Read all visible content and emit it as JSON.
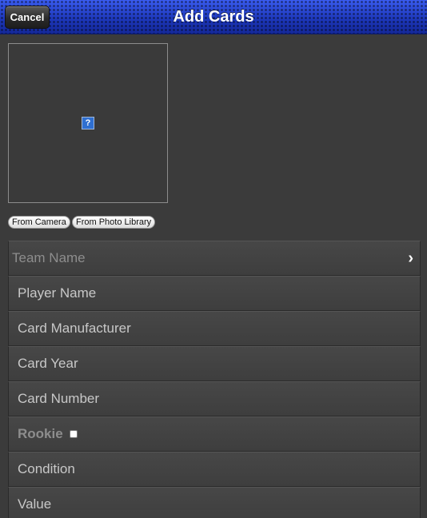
{
  "header": {
    "title": "Add Cards",
    "cancel_label": "Cancel"
  },
  "photo": {
    "placeholder_icon": "broken-image-icon",
    "placeholder_glyph": "?",
    "from_camera_label": "From Camera",
    "from_library_label": "From Photo Library"
  },
  "form": {
    "team_placeholder": "Team Name",
    "player_name_placeholder": "Player Name",
    "card_manufacturer_placeholder": "Card Manufacturer",
    "card_year_placeholder": "Card Year",
    "card_number_placeholder": "Card Number",
    "rookie_label": "Rookie",
    "rookie_checked": false,
    "condition_placeholder": "Condition",
    "value_placeholder": "Value"
  },
  "colors": {
    "header_blue": "#1f3fcf",
    "background": "#3b3b3b",
    "row_text": "#c8c8c8",
    "muted_text": "#8d8d8d"
  }
}
